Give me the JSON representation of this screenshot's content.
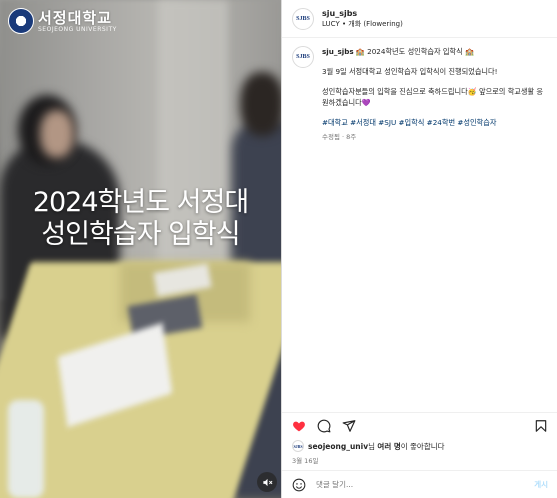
{
  "media": {
    "overlay_title_line1": "2024학년도 서정대",
    "overlay_title_line2": "성인학습자 입학식",
    "logo_name": "서정대학교",
    "logo_sub": "SEOJEONG UNIVERSITY",
    "mute_icon": "speaker-muted-icon"
  },
  "header": {
    "avatar_text": "SJBS",
    "username": "sju_sjbs",
    "audio": "LUCY • 개화 (Flowering)"
  },
  "caption": {
    "avatar_text": "SJBS",
    "username": "sju_sjbs",
    "title": "🏫 2024학년도 성인학습자 입학식 🏫",
    "line1": "3월 9일 서정대학교 성인학습자 입학식이 진행되었습니다!",
    "line2": "성인학습자분들의 입학을 진심으로 축하드립니다🥳 앞으로의 학교생활 응원하겠습니다💜",
    "hashtags": "#대학교 #서정대 #SJU #입학식 #24학번 #성인학습자",
    "meta": "수정됨 · 8주"
  },
  "actions": {
    "like_icon": "heart-filled-icon",
    "comment_icon": "comment-icon",
    "share_icon": "send-icon",
    "save_icon": "bookmark-icon",
    "like_color": "#ff3040"
  },
  "likes": {
    "avatar_text": "SJBS",
    "user": "seojeong_univ",
    "mid": "님 ",
    "others": "여러 명",
    "suffix": "이 좋아합니다"
  },
  "date": "3월 16일",
  "comment": {
    "emoji_icon": "smiley-icon",
    "placeholder": "댓글 달기...",
    "post_label": "게시"
  }
}
